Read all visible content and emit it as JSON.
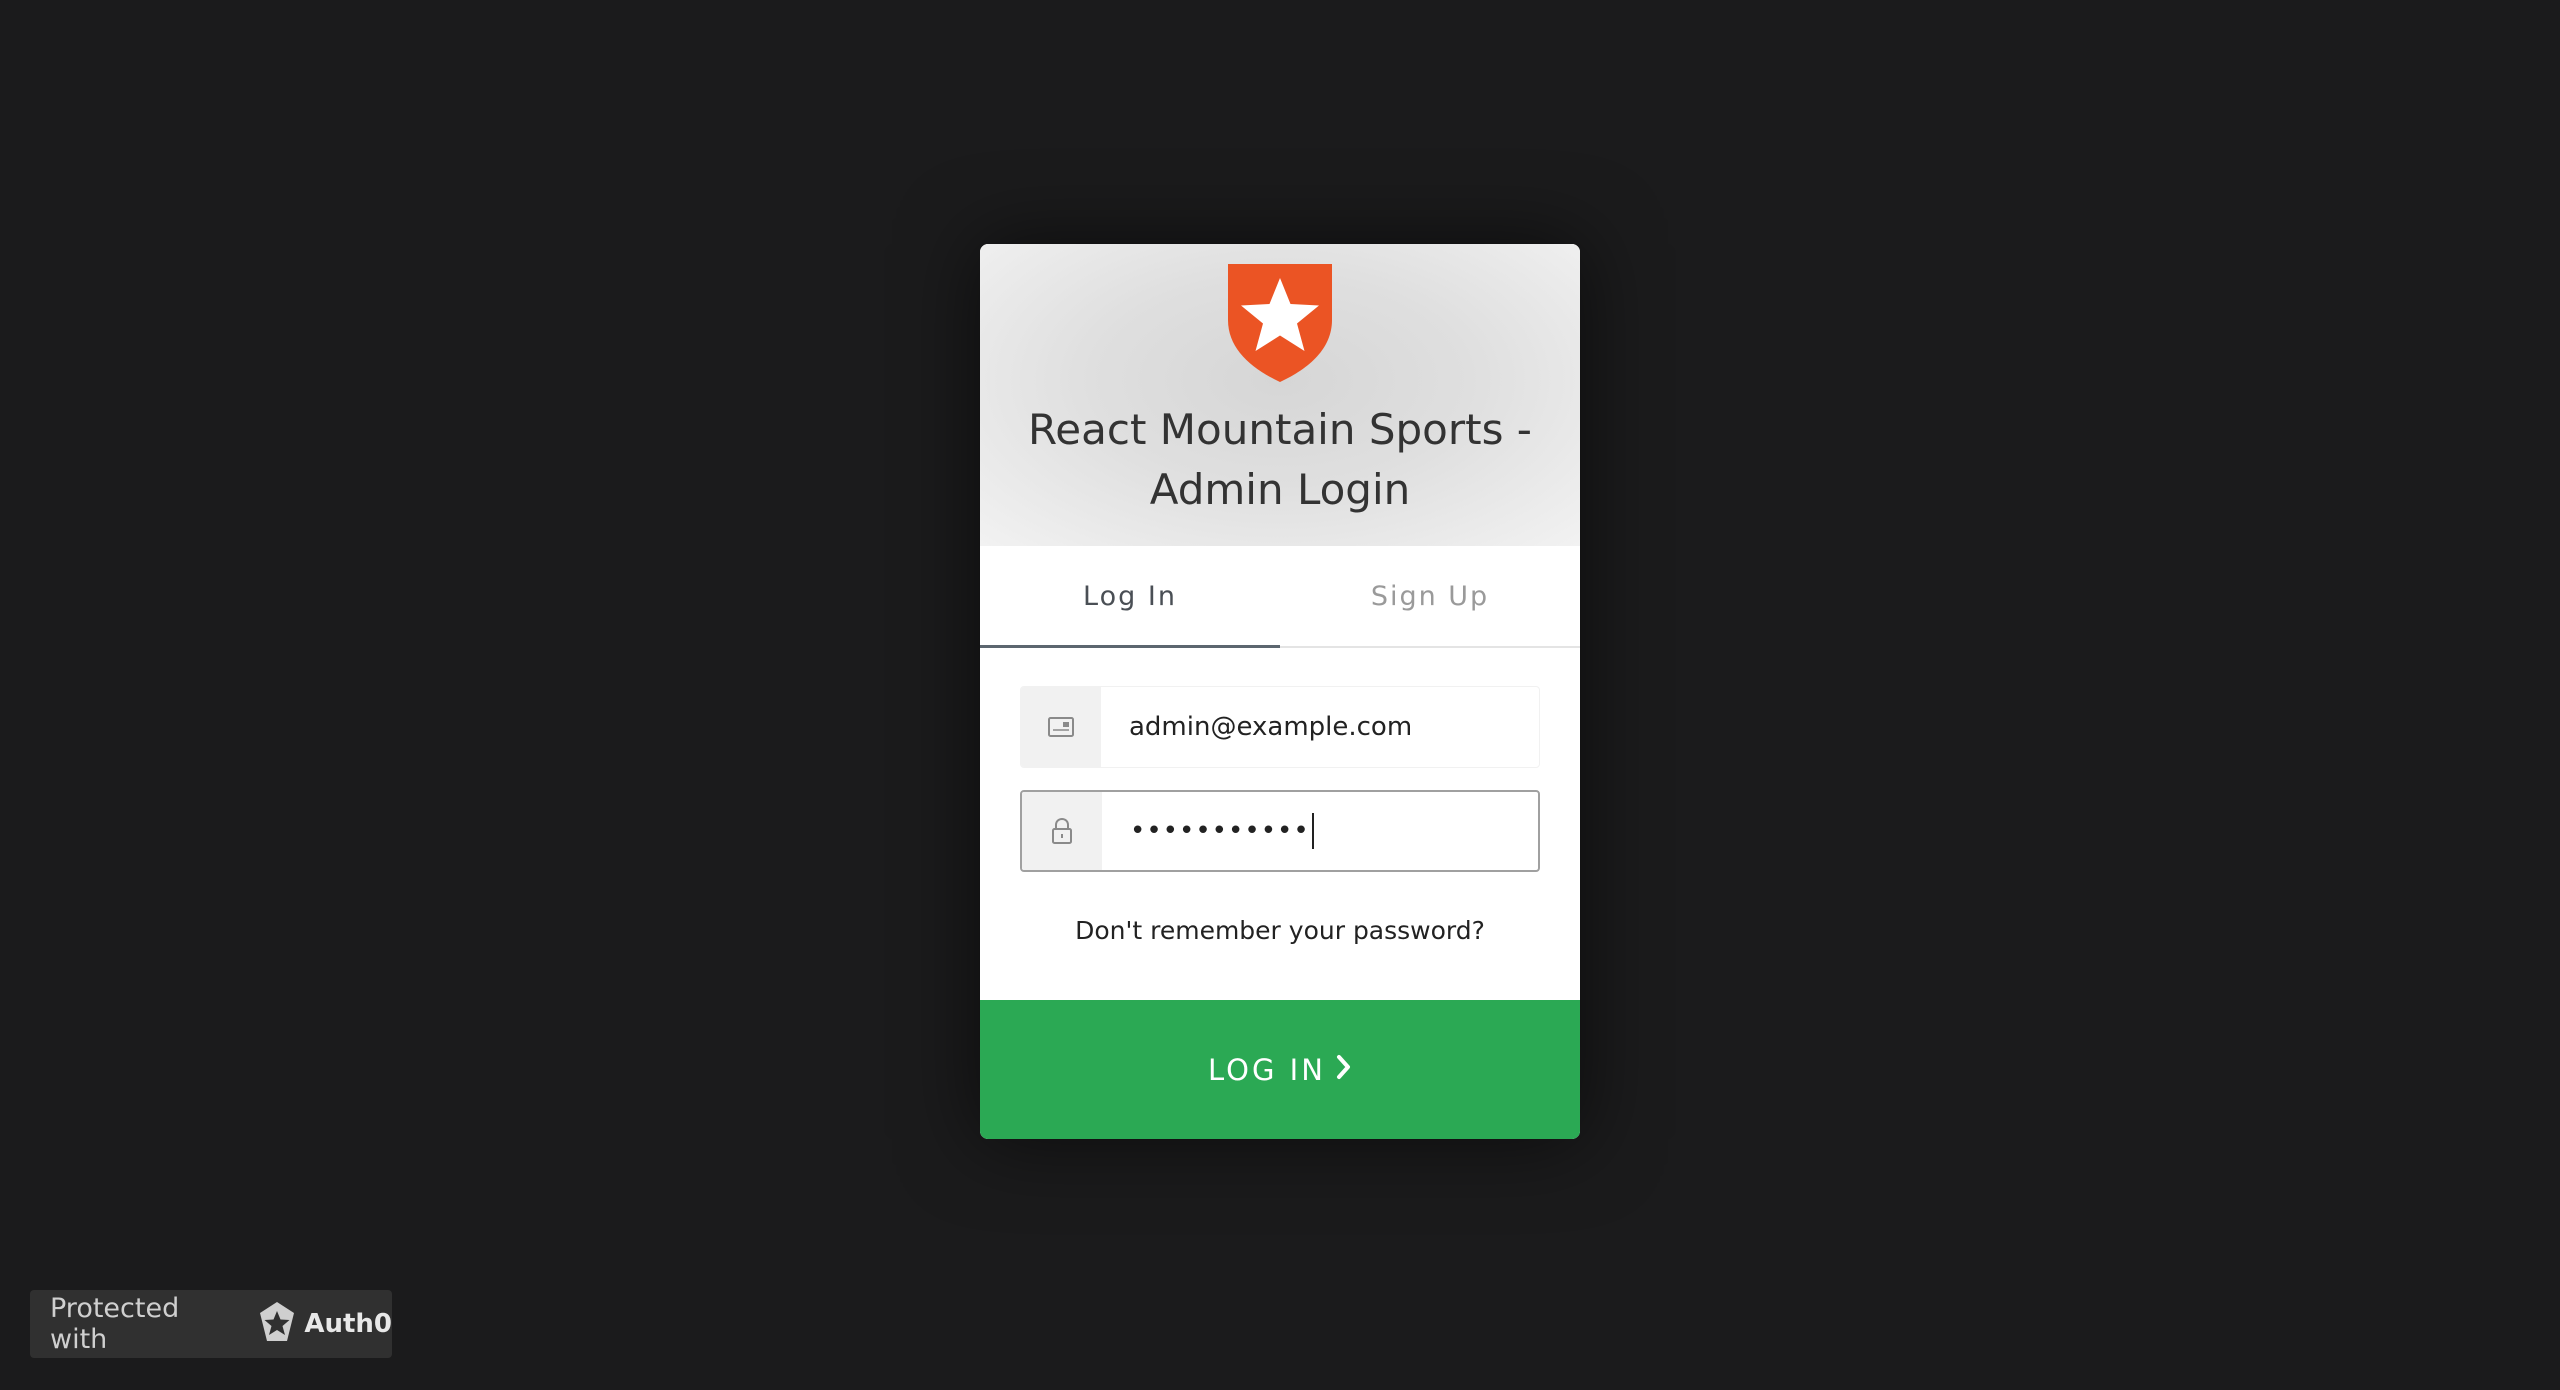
{
  "header": {
    "title": "React Mountain Sports - Admin Login",
    "logo": "auth0-shield-logo",
    "logo_color": "#eb5424"
  },
  "tabs": [
    {
      "label": "Log In",
      "active": true
    },
    {
      "label": "Sign Up",
      "active": false
    }
  ],
  "form": {
    "email": {
      "icon": "envelope-icon",
      "value": "admin@example.com"
    },
    "password": {
      "icon": "lock-icon",
      "value": "•••••••••••"
    },
    "forgot_link": "Don't remember your password?"
  },
  "submit": {
    "label": "LOG IN",
    "icon": "chevron-right-icon",
    "color": "#2ba954"
  },
  "footer_badge": {
    "label": "Protected with",
    "brand": "Auth0",
    "icon": "auth0-badge-icon"
  }
}
